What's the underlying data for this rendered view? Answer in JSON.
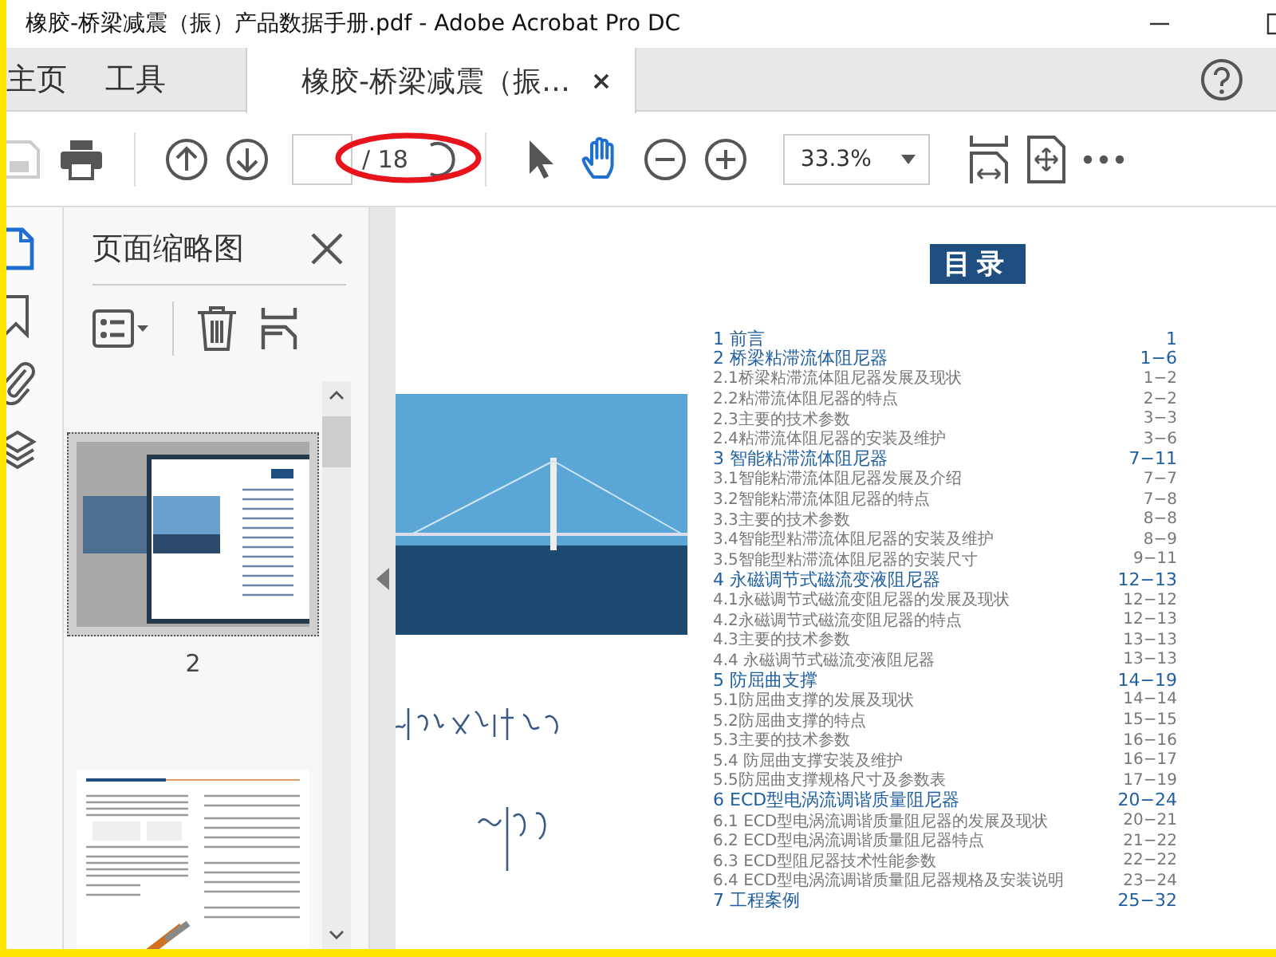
{
  "window": {
    "title": "橡胶-桥梁减震（振）产品数据手册.pdf - Adobe Acrobat Pro DC"
  },
  "tabs": [
    {
      "label": "主页",
      "selected": false
    },
    {
      "label": "工具",
      "selected": false
    },
    {
      "label": "橡胶-桥梁减震（振…",
      "selected": true
    }
  ],
  "toolbar": {
    "page_count": "/ 18",
    "zoom": "33.3%",
    "tools": [
      {
        "kind": "select",
        "selected": false
      },
      {
        "kind": "hand",
        "selected": true
      }
    ]
  },
  "nav_panels": [
    {
      "kind": "pages",
      "selected": true
    },
    {
      "kind": "bookmarks",
      "selected": false
    },
    {
      "kind": "attachments",
      "selected": false
    },
    {
      "kind": "layers",
      "selected": false
    }
  ],
  "thumbnails_panel": {
    "title": "页面缩略图",
    "thumbnails": [
      {
        "label": "2",
        "selected": true
      },
      {
        "selected": false
      }
    ]
  },
  "document": {
    "toc_title": "目录",
    "toc": [
      {
        "kind": "chapter",
        "title": "1 前言",
        "pages": "1"
      },
      {
        "kind": "chapter",
        "title": "2 桥梁粘滞流体阻尼器",
        "pages": "1−6"
      },
      {
        "kind": "section",
        "title": "2.1桥梁粘滞流体阻尼器发展及现状",
        "pages": "1−2"
      },
      {
        "kind": "section",
        "title": "2.2粘滞流体阻尼器的特点",
        "pages": "2−2"
      },
      {
        "kind": "section",
        "title": "2.3主要的技术参数",
        "pages": "3−3"
      },
      {
        "kind": "section",
        "title": "2.4粘滞流体阻尼器的安装及维护",
        "pages": "3−6"
      },
      {
        "kind": "chapter",
        "title": "3 智能粘滞流体阻尼器",
        "pages": "7−11"
      },
      {
        "kind": "section",
        "title": "3.1智能粘滞流体阻尼器发展及介绍",
        "pages": "7−7"
      },
      {
        "kind": "section",
        "title": "3.2智能粘滞流体阻尼器的特点",
        "pages": "7−8"
      },
      {
        "kind": "section",
        "title": "3.3主要的技术参数",
        "pages": "8−8"
      },
      {
        "kind": "section",
        "title": "3.4智能型粘滞流体阻尼器的安装及维护",
        "pages": "8−9"
      },
      {
        "kind": "section",
        "title": "3.5智能型粘滞流体阻尼器的安装尺寸",
        "pages": "9−11"
      },
      {
        "kind": "chapter",
        "title": "4 永磁调节式磁流变液阻尼器",
        "pages": "12−13"
      },
      {
        "kind": "section",
        "title": "4.1永磁调节式磁流变阻尼器的发展及现状",
        "pages": "12−12"
      },
      {
        "kind": "section",
        "title": "4.2永磁调节式磁流变阻尼器的特点",
        "pages": "12−13"
      },
      {
        "kind": "section",
        "title": "4.3主要的技术参数",
        "pages": "13−13"
      },
      {
        "kind": "section",
        "title": "4.4 永磁调节式磁流变液阻尼器",
        "pages": "13−13"
      },
      {
        "kind": "chapter",
        "title": "5 防屈曲支撑",
        "pages": "14−19"
      },
      {
        "kind": "section",
        "title": "5.1防屈曲支撑的发展及现状",
        "pages": "14−14"
      },
      {
        "kind": "section",
        "title": "5.2防屈曲支撑的特点",
        "pages": "15−15"
      },
      {
        "kind": "section",
        "title": "5.3主要的技术参数",
        "pages": "16−16"
      },
      {
        "kind": "section",
        "title": "5.4 防屈曲支撑安装及维护",
        "pages": "16−17"
      },
      {
        "kind": "section",
        "title": "5.5防屈曲支撑规格尺寸及参数表",
        "pages": "17−19"
      },
      {
        "kind": "chapter",
        "title": "6 ECD型电涡流调谐质量阻尼器",
        "pages": "20−24"
      },
      {
        "kind": "section",
        "title": "6.1 ECD型电涡流调谐质量阻尼器的发展及现状",
        "pages": "20−21"
      },
      {
        "kind": "section",
        "title": "6.2 ECD型电涡流调谐质量阻尼器特点",
        "pages": "21−22"
      },
      {
        "kind": "section",
        "title": "6.3 ECD型阻尼器技术性能参数",
        "pages": "22−22"
      },
      {
        "kind": "section",
        "title": "6.4 ECD型电涡流调谐质量阻尼器规格及安装说明",
        "pages": "23−24"
      },
      {
        "kind": "chapter",
        "title": "7 工程案例",
        "pages": "25−32"
      }
    ]
  }
}
